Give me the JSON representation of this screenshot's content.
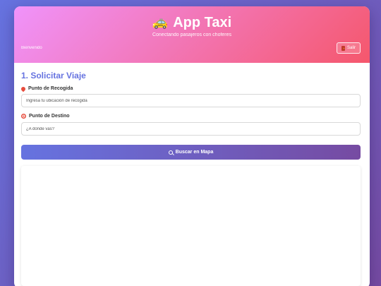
{
  "header": {
    "app_icon": "taxi-icon",
    "app_title": "App Taxi",
    "subtitle": "Conectando pasajeros con choferes",
    "welcome": "Bienvenido",
    "logout_icon": "door-icon",
    "logout_label": "Salir"
  },
  "request": {
    "section_title": "1. Solicitar Viaje",
    "pickup": {
      "icon": "pin-icon",
      "label": "Punto de Recogida",
      "placeholder": "Ingresa tu ubicación de recogida",
      "value": ""
    },
    "destination": {
      "icon": "target-icon",
      "label": "Punto de Destino",
      "placeholder": "¿A dónde vas?",
      "value": ""
    },
    "search_icon": "search-icon",
    "search_label": "Buscar en Mapa"
  },
  "colors": {
    "page_gradient_start": "#6673e0",
    "page_gradient_end": "#764ba2",
    "header_gradient_start": "#f093fb",
    "header_gradient_end": "#f5576c",
    "accent": "#6673e0"
  }
}
